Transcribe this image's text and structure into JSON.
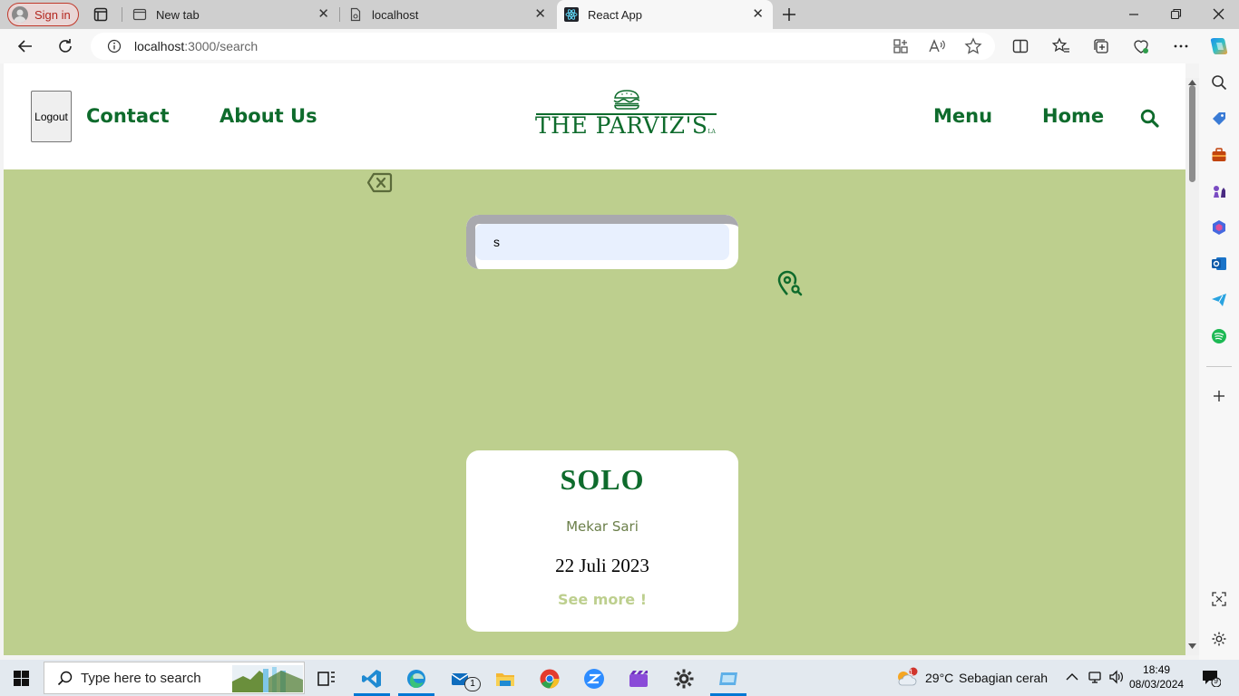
{
  "browser": {
    "profile_label": "Sign in",
    "tabs": [
      {
        "title": "New tab"
      },
      {
        "title": "localhost"
      },
      {
        "title": "React App"
      }
    ],
    "url_host": "localhost",
    "url_path": ":3000/search"
  },
  "site": {
    "logout_label": "Logout",
    "nav_left": [
      "Contact",
      "About Us"
    ],
    "nav_right": [
      "Menu",
      "Home"
    ],
    "logo_text": "THE PARVIZ'S",
    "logo_small": "LA",
    "search_value": "s",
    "card": {
      "title": "SOLO",
      "subtitle": "Mekar Sari",
      "date": "22 Juli 2023",
      "link": "See more !"
    }
  },
  "taskbar": {
    "search_placeholder": "Type here to search",
    "weather_temp": "29°C",
    "weather_desc": "Sebagian cerah",
    "weather_badge": "1",
    "mail_badge": "1",
    "time": "18:49",
    "date": "08/03/2024",
    "notification_count": "9"
  },
  "colors": {
    "page_bg": "#bdcf8e",
    "brand_green": "#0e6b2c"
  }
}
